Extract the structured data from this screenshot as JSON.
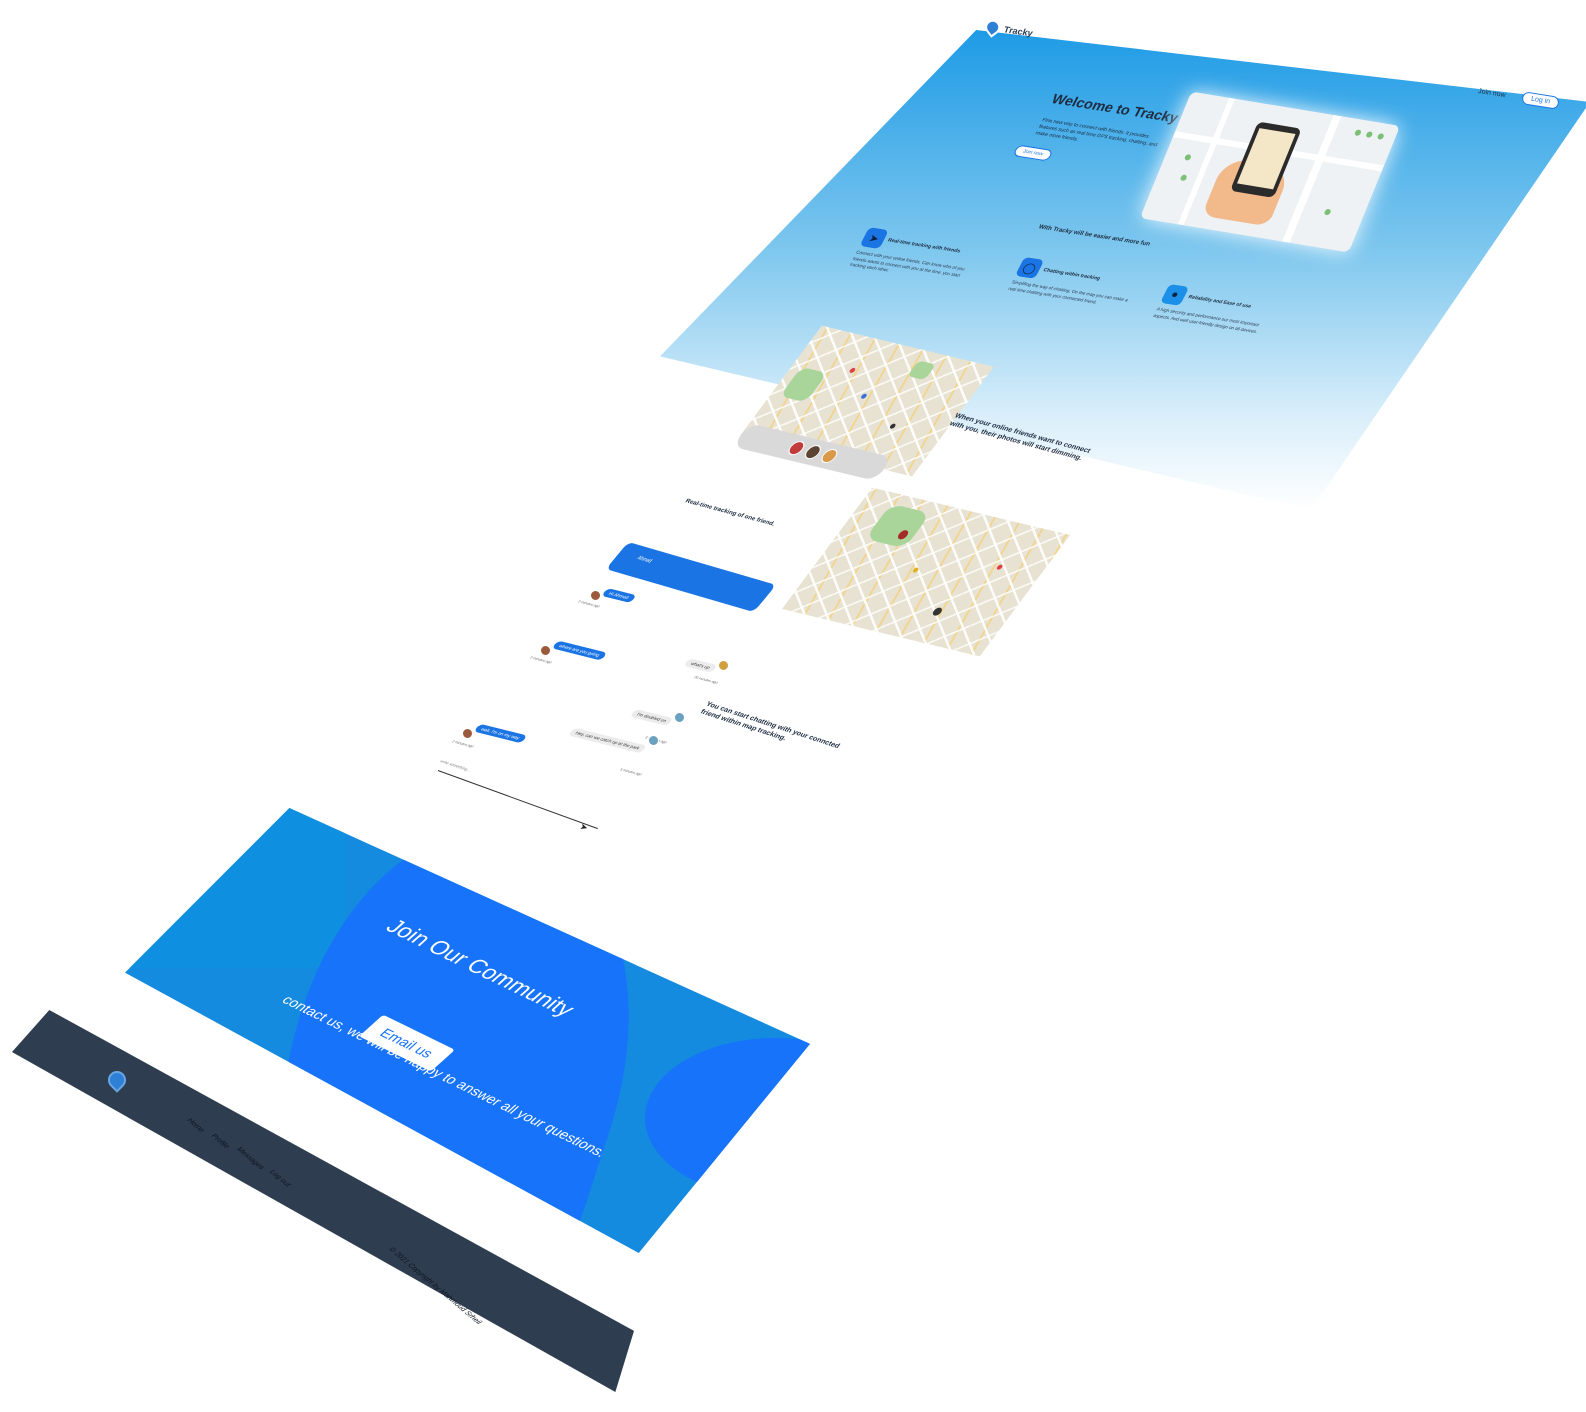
{
  "header": {
    "brand": "Tracky",
    "join_label": "Join now",
    "login_label": "Log in"
  },
  "hero": {
    "title": "Welcome to Tracky",
    "intro": "Fine new way to connect with friends. It provides features such as real time GPS tracking, chatting, and make more friends.",
    "cta_label": "Join now"
  },
  "features": {
    "title": "With Tracky will be easier and more fun",
    "items": [
      {
        "icon": "navigation-arrow-icon",
        "title": "Real-time tracking with friends",
        "desc": "Connect with your online friends. Can know who of you friends wants to connect with you at the time. you start tracking each other."
      },
      {
        "icon": "chat-bubble-icon",
        "title": "Chatting within tracking",
        "desc": "Simplifing the way of chatting. On the map you can make a real time chatting with your connected friend."
      },
      {
        "icon": "lightbulb-icon",
        "title": "Reliability and Ease of use",
        "desc": "A high security and performance our most important aspects. And well user-friendly design on all devices."
      }
    ]
  },
  "showcase": {
    "connect_caption": "When your online friends want to connect with you, their photos will start dimming.",
    "tracking_caption": "Real-time tracking of one friend.",
    "chat_caption": "You can start chatting with your conncted friend within map tracking."
  },
  "chat": {
    "contact_name": "Ahmed",
    "messages": [
      {
        "text": "Hi Ahmed",
        "meta": "2 minutes ago",
        "side": "me"
      },
      {
        "text": "where are you going",
        "meta": "2 minutes ago",
        "side": "me"
      },
      {
        "text": "what's up",
        "meta": "20 minutes ago",
        "side": "them"
      },
      {
        "text": "I'm doubled on",
        "meta": "3 minutes ago",
        "side": "them"
      },
      {
        "text": "wait, i'm on my way",
        "meta": "2 minutes ago",
        "side": "me"
      },
      {
        "text": "Hey, can we catch up at the park",
        "meta": "5 minutes ago",
        "side": "them"
      }
    ],
    "input_placeholder": "write something..."
  },
  "community": {
    "title": "Join Our Community",
    "subtitle": "contact us, we will be happy to answer all your questions.",
    "button_label": "Email us"
  },
  "footer": {
    "links": [
      "Home",
      "Profile",
      "Messages",
      "Log out"
    ],
    "copyright": "© 2021 Copyright by Mahmoud Srheil"
  },
  "colors": {
    "primary": "#1b74e4",
    "community_blue": "#1673fa",
    "community_light": "#158be0",
    "footer_bg": "#2e3d50"
  }
}
